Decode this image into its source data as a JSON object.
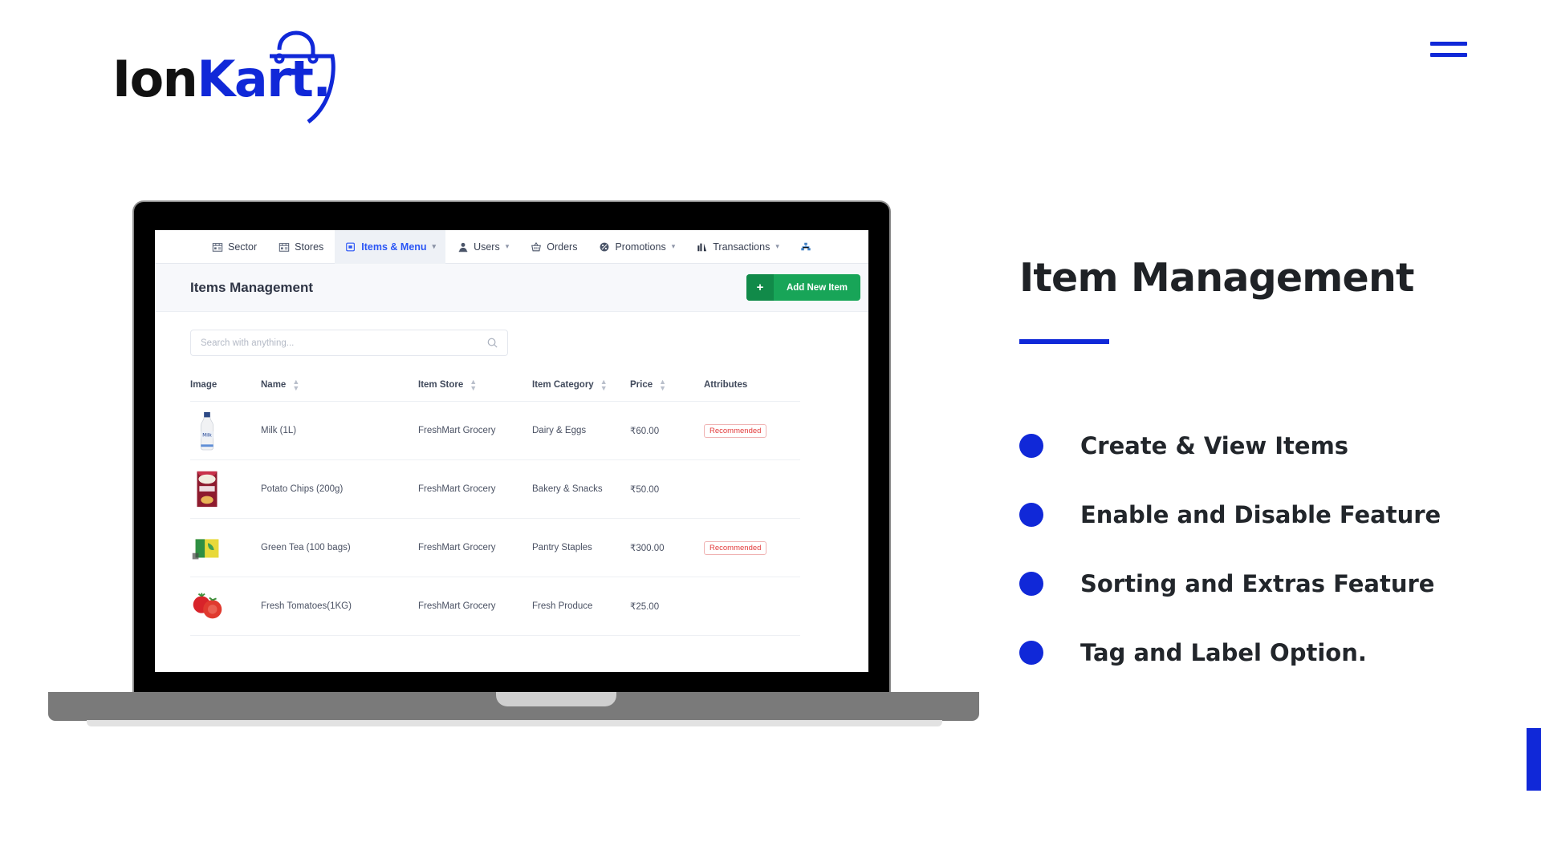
{
  "brand": {
    "name_dark": "Ion",
    "name_accent": "Kart.",
    "accent_color": "#1028d8",
    "bag_icon": "shopping-bag-icon"
  },
  "header": {
    "menu_icon": "hamburger-menu-icon"
  },
  "feature_panel": {
    "title": "Item Management",
    "accent_color": "#1028d8",
    "bullets": [
      {
        "label": "Create & View Items"
      },
      {
        "label": "Enable and Disable Feature"
      },
      {
        "label": "Sorting and Extras Feature"
      },
      {
        "label": "Tag and Label Option."
      }
    ]
  },
  "app": {
    "nav": [
      {
        "label": "Sector",
        "icon": "store-building-icon",
        "active": false,
        "caret": false
      },
      {
        "label": "Stores",
        "icon": "store-building-icon",
        "active": false,
        "caret": false
      },
      {
        "label": "Items & Menu",
        "icon": "items-menu-icon",
        "active": true,
        "caret": true
      },
      {
        "label": "Users",
        "icon": "user-icon",
        "active": false,
        "caret": true
      },
      {
        "label": "Orders",
        "icon": "basket-icon",
        "active": false,
        "caret": false
      },
      {
        "label": "Promotions",
        "icon": "promotion-tag-icon",
        "active": false,
        "caret": true
      },
      {
        "label": "Transactions",
        "icon": "bar-chart-icon",
        "active": false,
        "caret": true
      },
      {
        "label": "",
        "icon": "sitemap-icon",
        "active": false,
        "caret": false
      }
    ],
    "page_title": "Items Management",
    "actions": {
      "add_new_item": {
        "label": "Add New Item",
        "icon": "plus-icon",
        "color": "#18a558"
      },
      "import_item": {
        "label": "",
        "icon": "import-list-icon",
        "color": "#18a558"
      }
    },
    "search": {
      "placeholder": "Search with anything...",
      "value": "",
      "icon": "search-icon"
    },
    "table": {
      "columns": [
        {
          "label": "Image",
          "sortable": false
        },
        {
          "label": "Name",
          "sortable": true
        },
        {
          "label": "Item Store",
          "sortable": true
        },
        {
          "label": "Item Category",
          "sortable": true
        },
        {
          "label": "Price",
          "sortable": true
        },
        {
          "label": "Attributes",
          "sortable": false
        }
      ],
      "rows": [
        {
          "image_alt": "milk-bottle-thumbnail",
          "name": "Milk (1L)",
          "store": "FreshMart Grocery",
          "category": "Dairy & Eggs",
          "price": "₹60.00",
          "attribute": "Recommended"
        },
        {
          "image_alt": "potato-chips-packet-thumbnail",
          "name": "Potato Chips (200g)",
          "store": "FreshMart Grocery",
          "category": "Bakery & Snacks",
          "price": "₹50.00",
          "attribute": ""
        },
        {
          "image_alt": "green-tea-box-thumbnail",
          "name": "Green Tea (100 bags)",
          "store": "FreshMart Grocery",
          "category": "Pantry Staples",
          "price": "₹300.00",
          "attribute": "Recommended"
        },
        {
          "image_alt": "fresh-tomatoes-thumbnail",
          "name": "Fresh Tomatoes(1KG)",
          "store": "FreshMart Grocery",
          "category": "Fresh Produce",
          "price": "₹25.00",
          "attribute": ""
        }
      ]
    }
  }
}
